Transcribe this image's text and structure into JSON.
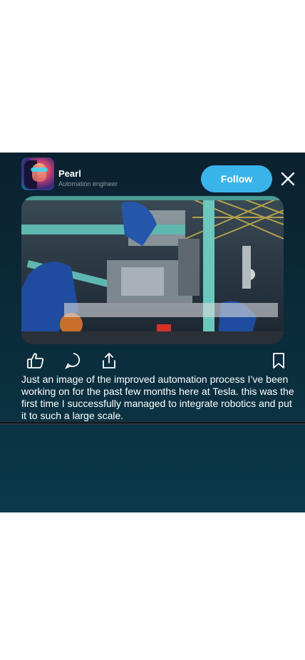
{
  "post": {
    "author": {
      "name": "Pearl",
      "title": "Automation engineer"
    },
    "follow_label": "Follow",
    "caption": "Just an image of the improved automation process I’ve been working on for the past few months here at Tesla. this was the first time I successfully managed to integrate robotics and put it to such a large scale.",
    "image_description": "robotic-assembly-line-photo"
  },
  "icons": {
    "close": "close-icon",
    "like": "thumbs-up-icon",
    "comment": "comment-icon",
    "share": "share-icon",
    "save": "bookmark-icon"
  },
  "colors": {
    "card_bg": "#0b2b3b",
    "accent": "#3ab3ea",
    "text": "#ffffff",
    "muted": "#8c9ba6"
  }
}
